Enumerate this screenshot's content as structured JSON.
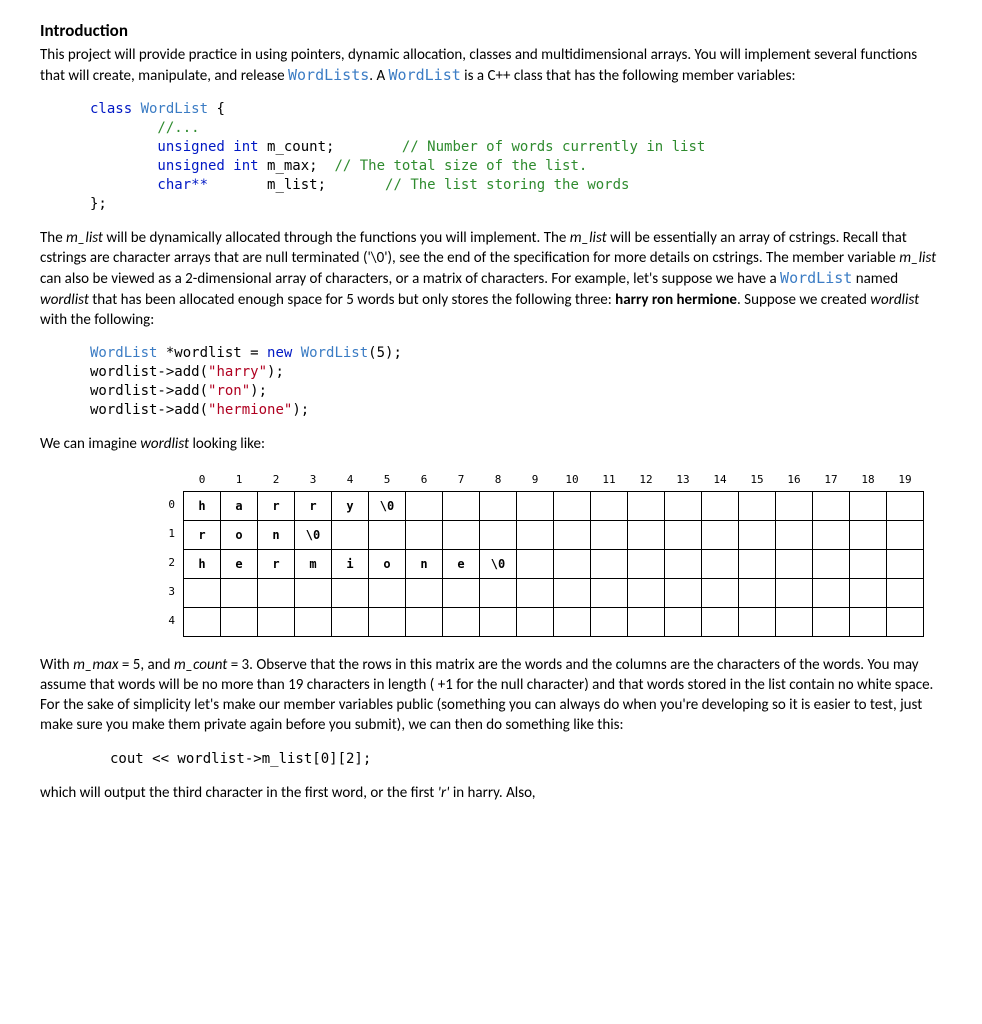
{
  "intro_heading": "Introduction",
  "para1_a": "This project will provide practice in using pointers, dynamic allocation, classes and multidimensional arrays.  You will implement several functions that will create, manipulate, and release ",
  "para1_wordlists": "WordLists",
  "para1_b": ".  A ",
  "para1_wordlist": "WordList",
  "para1_c": " is a C++ class that has the following member variables:",
  "code1": {
    "l1a": "class ",
    "l1b": "WordList",
    "l1c": " {",
    "l2": "        //...",
    "l3a": "        unsigned int ",
    "l3b": "m_count;",
    "l3c": "        // Number of words currently in list",
    "l4a": "        unsigned int ",
    "l4b": "m_max;",
    "l4c": "  // The total size of the list.",
    "l5a": "        char**       ",
    "l5b": "m_list;",
    "l5c": "       // The list storing the words",
    "l6": "};"
  },
  "para2_a": "The ",
  "para2_mlist1": "m_list",
  "para2_b": " will be dynamically allocated through the functions you will implement. The ",
  "para2_mlist2": "m_list",
  "para2_c": " will be essentially an array of cstrings.  Recall that cstrings are character arrays that are null terminated ('\\0'), see the end of the specification for more details on cstrings.  The member variable ",
  "para2_mlist3": "m_list",
  "para2_d": " can also be viewed as a 2-dimensional array of characters, or a matrix of characters.  For example, let's suppose we have a ",
  "para2_wordlist": "WordList",
  "para2_e": " named ",
  "para2_wordlist_it": "wordlist",
  "para2_f": " that has been allocated enough space for 5 words but only stores the following three: ",
  "para2_words": "harry ron hermione",
  "para2_g": ". Suppose we created  ",
  "para2_wordlist_it2": "wordlist",
  "para2_h": "  with the following:",
  "code2": {
    "l1a": "WordList ",
    "l1b": "*wordlist = ",
    "l1c": "new ",
    "l1d": "WordList",
    "l1e": "(5);",
    "l2a": "wordlist->add(",
    "l2b": "\"harry\"",
    "l2c": ");",
    "l3a": "wordlist->add(",
    "l3b": "\"ron\"",
    "l3c": ");",
    "l4a": "wordlist->add(",
    "l4b": "\"hermione\"",
    "l4c": ");"
  },
  "para3_a": "We can imagine ",
  "para3_b": "wordlist",
  "para3_c": " looking like:",
  "grid": {
    "cols": [
      "0",
      "1",
      "2",
      "3",
      "4",
      "5",
      "6",
      "7",
      "8",
      "9",
      "10",
      "11",
      "12",
      "13",
      "14",
      "15",
      "16",
      "17",
      "18",
      "19"
    ],
    "rows": [
      "0",
      "1",
      "2",
      "3",
      "4"
    ],
    "data": [
      [
        "h",
        "a",
        "r",
        "r",
        "y",
        "\\0",
        "",
        "",
        "",
        "",
        "",
        "",
        "",
        "",
        "",
        "",
        "",
        "",
        "",
        ""
      ],
      [
        "r",
        "o",
        "n",
        "\\0",
        "",
        "",
        "",
        "",
        "",
        "",
        "",
        "",
        "",
        "",
        "",
        "",
        "",
        "",
        "",
        ""
      ],
      [
        "h",
        "e",
        "r",
        "m",
        "i",
        "o",
        "n",
        "e",
        "\\0",
        "",
        "",
        "",
        "",
        "",
        "",
        "",
        "",
        "",
        "",
        ""
      ],
      [
        "",
        "",
        "",
        "",
        "",
        "",
        "",
        "",
        "",
        "",
        "",
        "",
        "",
        "",
        "",
        "",
        "",
        "",
        "",
        ""
      ],
      [
        "",
        "",
        "",
        "",
        "",
        "",
        "",
        "",
        "",
        "",
        "",
        "",
        "",
        "",
        "",
        "",
        "",
        "",
        "",
        ""
      ]
    ]
  },
  "para4_a": "With ",
  "para4_mmax": "m_max",
  "para4_b": " = 5, and ",
  "para4_mcount": "m_count",
  "para4_c": " = 3. Observe that the rows in this matrix are the words and the columns are the characters of the words.  You may assume that words will be no more than 19 characters in length ( +1 for the null character) and that words stored in the list contain no white space.   For the sake of simplicity let's make our member variables public (something you can always do when you're developing so it is easier to test, just make sure you make them private again before you submit), we can then do something like this:",
  "code3": "cout << wordlist->m_list[0][2];",
  "para5_a": "which will output the third character in the first word, or the first ",
  "para5_r": "'r'",
  "para5_b": "  in harry.  Also,"
}
